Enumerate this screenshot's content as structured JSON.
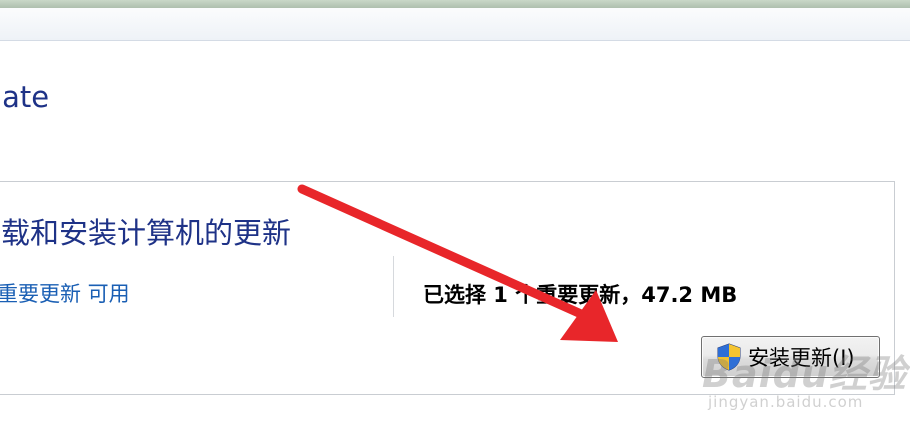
{
  "header": {
    "title": "odate"
  },
  "panel": {
    "heading": "下载和安装计算机的更新",
    "available_link": "个重要更新 可用",
    "selected_summary": "已选择 1 个重要更新，47.2 MB",
    "install_button_label": "安装更新(I)"
  },
  "watermark": {
    "brand": "Baidu经验",
    "url": "jingyan.baidu.com"
  },
  "colors": {
    "heading_blue": "#1e3287",
    "link_blue": "#1a5fb4",
    "arrow_red": "#e8262a"
  },
  "icons": {
    "install_button_icon": "uac-shield-icon"
  }
}
